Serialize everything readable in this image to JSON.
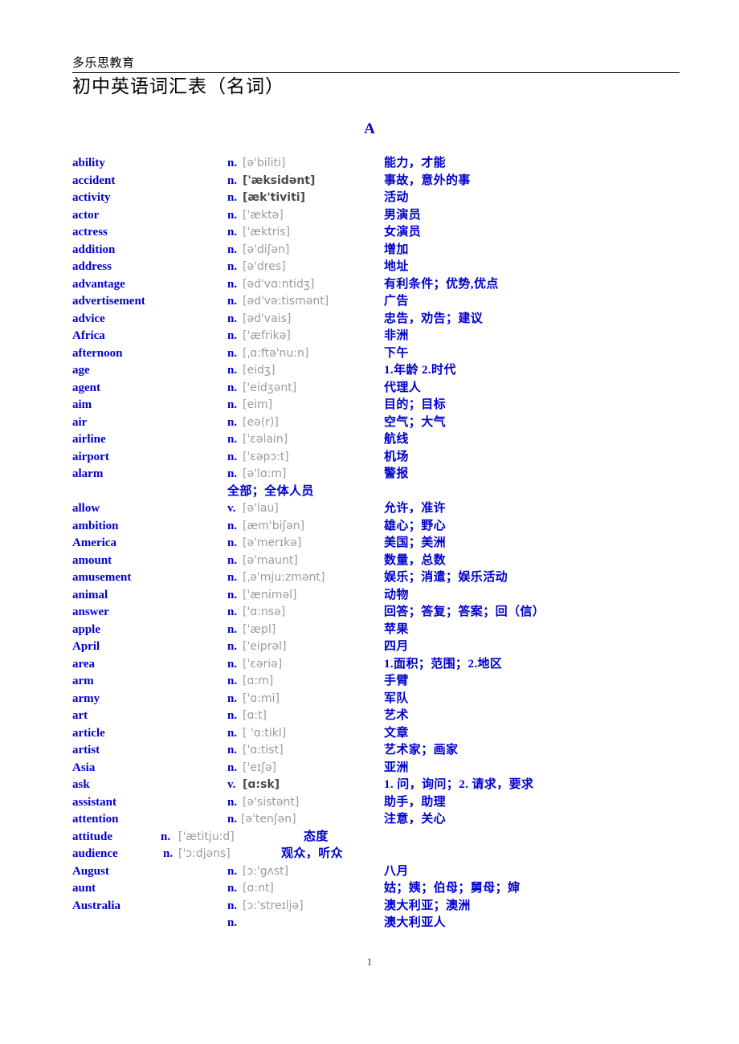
{
  "header": {
    "org": "多乐思教育",
    "title": "初中英语词汇表（名词）"
  },
  "section": {
    "letter": "A"
  },
  "footer": {
    "page_number": "1"
  },
  "colors": {
    "word_blue": "#0000cd",
    "ipa_gray": "#9b9b9b",
    "ipa_strong": "#4a4a4a",
    "rule_black": "#000000"
  },
  "entries": [
    {
      "word": "ability",
      "pos": "n.",
      "ipa": "[ə'biliti]",
      "cn": "能力，才能",
      "strong": false
    },
    {
      "word": "accident",
      "pos": "n.",
      "ipa": "['æksidənt]",
      "cn": "事故，意外的事",
      "strong": true
    },
    {
      "word": "activity",
      "pos": "n.",
      "ipa": "[æk'tiviti]",
      "cn": "活动",
      "strong": true
    },
    {
      "word": "actor",
      "pos": "n.",
      "ipa": "['æktə]",
      "cn": "男演员",
      "strong": false
    },
    {
      "word": "actress",
      "pos": "n.",
      "ipa": "['æktris]",
      "cn": "女演员",
      "strong": false
    },
    {
      "word": "addition",
      "pos": "n.",
      "ipa": "[ə'diʃən]",
      "cn": "增加",
      "strong": false
    },
    {
      "word": "address",
      "pos": "n.",
      "ipa": "[ə'dres]",
      "cn": "地址",
      "strong": false
    },
    {
      "word": "advantage",
      "pos": "n.",
      "ipa": "[əd'vɑ:ntidʒ]",
      "cn": "有利条件；优势,优点",
      "strong": false
    },
    {
      "word": "advertisement",
      "pos": "n.",
      "ipa": "[əd'və:tismənt]",
      "cn": "广告",
      "strong": false
    },
    {
      "word": "advice",
      "pos": "n.",
      "ipa": "[əd'vais]",
      "cn": "忠告，劝告；建议",
      "strong": false
    },
    {
      "word": "Africa",
      "pos": "n.",
      "ipa": "['æfrikə]",
      "cn": "非洲",
      "strong": false
    },
    {
      "word": "afternoon",
      "pos": "n.",
      "ipa": "[ˌɑ:ftə'nu:n]",
      "cn": "下午",
      "strong": false
    },
    {
      "word": "age",
      "pos": "n.",
      "ipa": "[eidʒ]",
      "cn": "1.年龄 2.时代",
      "strong": false
    },
    {
      "word": "agent",
      "pos": "n.",
      "ipa": "['eidʒənt]",
      "cn": "代理人",
      "strong": false
    },
    {
      "word": "aim",
      "pos": "n.",
      "ipa": "[eim]",
      "cn": "目的；目标",
      "strong": false
    },
    {
      "word": "air",
      "pos": "n.",
      "ipa": "[eə(r)]",
      "cn": "空气；大气",
      "strong": false
    },
    {
      "word": "airline",
      "pos": "n.",
      "ipa": "['ɛəlain]",
      "cn": "航线",
      "strong": false
    },
    {
      "word": "airport",
      "pos": "n.",
      "ipa": "['ɛəpɔ:t]",
      "cn": "机场",
      "strong": false
    },
    {
      "word": "alarm",
      "pos": "n.",
      "ipa": "[ə'lɑ:m]",
      "cn": "警报",
      "strong": false
    },
    {
      "orphan": "全部；全体人员"
    },
    {
      "word": "allow",
      "pos": "v.",
      "ipa": "[ə'lau]",
      "cn": "允许，准许",
      "strong": false
    },
    {
      "word": "ambition",
      "pos": "n.",
      "ipa": "[æm'biʃən]",
      "cn": "雄心；野心",
      "strong": false
    },
    {
      "word": "America",
      "pos": "n.",
      "ipa": "[ə'merɪkə]",
      "cn": "美国；美洲",
      "strong": false
    },
    {
      "word": "amount",
      "pos": "n.",
      "ipa": "[ə'maunt]",
      "cn": "数量，总数",
      "strong": false
    },
    {
      "word": "amusement",
      "pos": "n.",
      "ipa": "[ˌə'mju:zmənt]",
      "cn": "娱乐；消遣；娱乐活动",
      "strong": false
    },
    {
      "word": "animal",
      "pos": "n.",
      "ipa": "['æniməl]",
      "cn": "动物",
      "strong": false
    },
    {
      "word": "answer",
      "pos": "n.",
      "ipa": "['ɑ:nsə]",
      "cn": "回答；答复；答案；回（信）",
      "strong": false
    },
    {
      "word": "apple",
      "pos": "n.",
      "ipa": "['æpl]",
      "cn": "苹果",
      "strong": false
    },
    {
      "word": "April",
      "pos": "n.",
      "ipa": "['eiprəl]",
      "cn": "四月",
      "strong": false
    },
    {
      "word": "area",
      "pos": "n.",
      "ipa": "['ɛəriə]",
      "cn": "1.面积；范围；2.地区",
      "strong": false
    },
    {
      "word": "arm",
      "pos": "n.",
      "ipa": "[ɑ:m]",
      "cn": "手臂",
      "strong": false
    },
    {
      "word": "army",
      "pos": "n.",
      "ipa": "['ɑ:mi]",
      "cn": "军队",
      "strong": false
    },
    {
      "word": "art",
      "pos": "n.",
      "ipa": "[ɑ:t]",
      "cn": "艺术",
      "strong": false
    },
    {
      "word": "article",
      "pos": "n.",
      "ipa": "[ 'ɑ:tikl]",
      "cn": "文章",
      "strong": false
    },
    {
      "word": "artist",
      "pos": "n.",
      "ipa": "['ɑ:tist]",
      "cn": "艺术家；画家",
      "strong": false
    },
    {
      "word": "Asia",
      "pos": "n.",
      "ipa": "['eɪʃə]",
      "cn": "亚洲",
      "strong": false
    },
    {
      "word": "ask",
      "pos": "v.",
      "ipa": "[ɑ:sk]",
      "cn": "1. 问，询问；2. 请求，要求",
      "strong": true
    },
    {
      "word": "assistant",
      "pos": "n.",
      "ipa": "[ə'sistənt]",
      "cn": "助手，助理",
      "strong": false
    },
    {
      "word": "attention",
      "pos": "n.",
      "ipa": "[ə'tenʃən]",
      "cn": "注意，关心",
      "strong": false,
      "tight": true
    },
    {
      "word": "attitude",
      "pos": "n.",
      "ipa": "['ætitju:d]",
      "cn": "态度",
      "strong": false,
      "shift": 1
    },
    {
      "word": "audience",
      "pos": "n.",
      "ipa": "['ɔ:djəns]",
      "cn": "观众，听众",
      "strong": false,
      "shift": 2
    },
    {
      "word": "August",
      "pos": "n.",
      "ipa": "[ɔ:'gʌst]",
      "cn": "八月",
      "strong": false
    },
    {
      "word": "aunt",
      "pos": "n.",
      "ipa": "[ɑ:nt]",
      "cn": "姑；姨；伯母；舅母；婶",
      "strong": false
    },
    {
      "word": "Australia",
      "pos": "n.",
      "ipa": "[ɔ:'streɪljə]",
      "cn": "澳大利亚；澳洲",
      "strong": false
    },
    {
      "word": "",
      "pos": "n.",
      "ipa": "",
      "cn": "澳大利亚人",
      "strong": false
    }
  ]
}
